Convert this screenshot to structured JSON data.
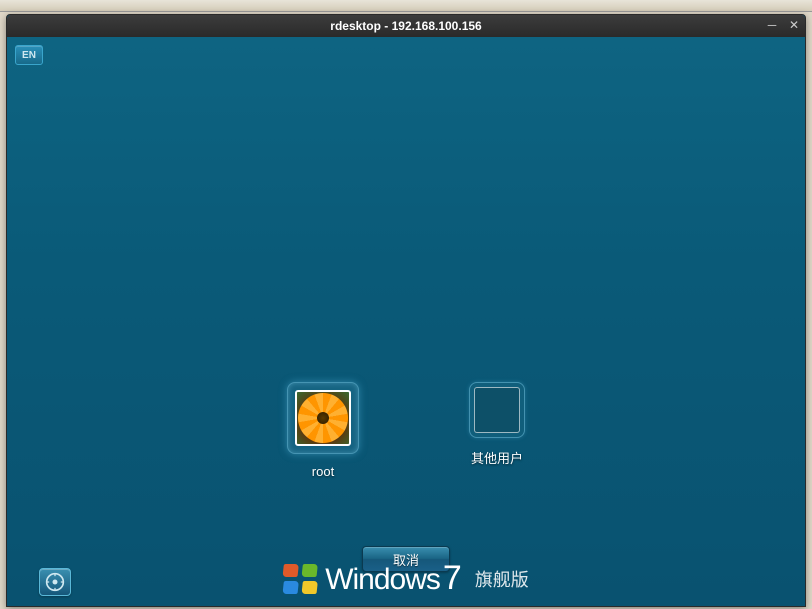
{
  "window": {
    "title": "rdesktop - 192.168.100.156"
  },
  "lang_indicator": "EN",
  "users": [
    {
      "label": "root",
      "avatar": "flower"
    },
    {
      "label": "其他用户",
      "avatar": "blank"
    }
  ],
  "buttons": {
    "cancel": "取消"
  },
  "branding": {
    "product": "Windows",
    "version": "7",
    "edition": "旗舰版"
  }
}
